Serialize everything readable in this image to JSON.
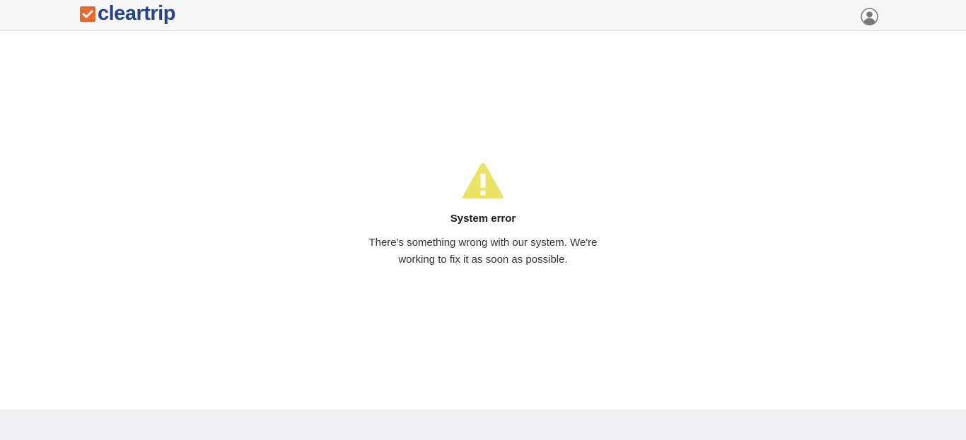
{
  "header": {
    "brand_name": "cleartrip",
    "account_icon": "user-avatar-icon",
    "logo_icon": "checkmark-icon"
  },
  "error": {
    "icon": "warning-triangle-icon",
    "title": "System error",
    "message": "There's something wrong with our system. We're working to fix it as soon as possible."
  },
  "colors": {
    "brand_orange": "#e7692f",
    "brand_blue": "#23428f",
    "warning_yellow": "#e9e262",
    "header_bg": "#f7f7f7",
    "footer_bg": "#efeff4"
  }
}
